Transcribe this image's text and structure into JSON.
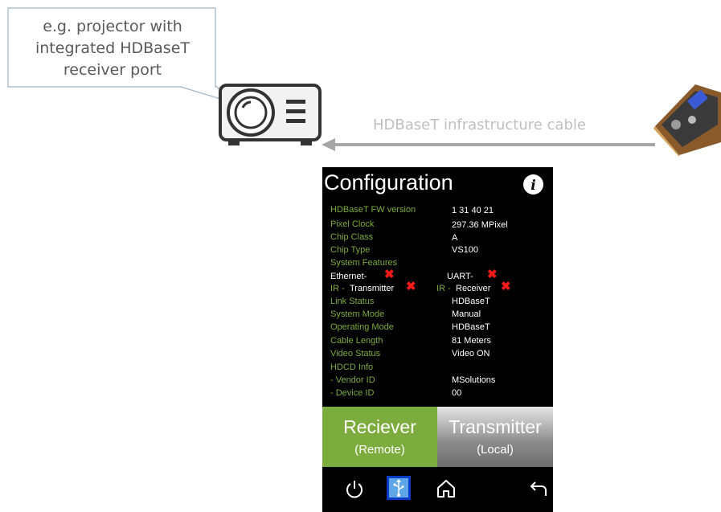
{
  "callout": {
    "text": "e.g. projector with integrated HDBaseT receiver port"
  },
  "cable": {
    "label": "HDBaseT infrastructure cable"
  },
  "panel": {
    "title": "Configuration",
    "rows": [
      {
        "label": "HDBaseT FW version",
        "value": "1    31   40   21"
      },
      {
        "label": "Pixel Clock",
        "value": "297.36    MPixel"
      },
      {
        "label": "Chip Class",
        "value": "A"
      },
      {
        "label": "Chip Type",
        "value": "VS100"
      },
      {
        "label": "System Features",
        "value": ""
      },
      {
        "label": "Link Status",
        "value": "HDBaseT"
      },
      {
        "label": "System Mode",
        "value": "Manual"
      },
      {
        "label": "Operating Mode",
        "value": "HDBaseT"
      },
      {
        "label": "Cable Length",
        "value": "81 Meters"
      },
      {
        "label": "Video Status",
        "value": "Video ON"
      },
      {
        "label": "HDCD Info",
        "value": ""
      },
      {
        "label": "- Vendor ID",
        "value": "MSolutions"
      },
      {
        "label": "- Device ID",
        "value": "00"
      }
    ],
    "features": {
      "ethernet": "Ethernet-",
      "uart": "UART-",
      "ir_prefix": "IR -",
      "ir_tx": "Transmitter",
      "ir_rx": "Receiver",
      "x_mark": "✖"
    },
    "buttons": {
      "receiver": {
        "label": "Reciever",
        "sub": "(Remote)"
      },
      "transmitter": {
        "label": "Transmitter",
        "sub": "(Local)"
      }
    },
    "nav_icons": [
      "power-icon",
      "usb-icon",
      "home-icon",
      "back-icon"
    ],
    "colors": {
      "label_green": "#7aac3b",
      "receiver_green": "#7dac3e",
      "x_red": "#ff1a1a"
    }
  }
}
